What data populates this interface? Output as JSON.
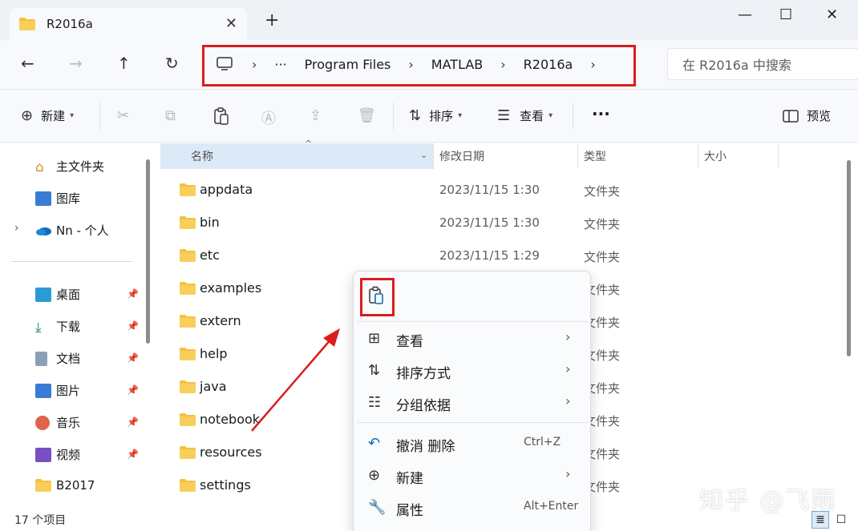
{
  "window": {
    "tab_title": "R2016a",
    "new_tab": "+",
    "minimize": "—",
    "maximize": "☐",
    "close": "✕"
  },
  "nav": {
    "breadcrumb": [
      "Program Files",
      "MATLAB",
      "R2016a"
    ],
    "ellipsis": "···",
    "search_placeholder": "在 R2016a 中搜索"
  },
  "toolbar": {
    "new_label": "新建",
    "sort_label": "排序",
    "view_label": "查看",
    "more_label": "···",
    "preview_label": "预览"
  },
  "sidebar": {
    "top": [
      {
        "label": "主文件夹",
        "icon": "home-icon"
      },
      {
        "label": "图库",
        "icon": "gallery-icon"
      },
      {
        "label": "Nn - 个人",
        "icon": "onedrive-icon"
      }
    ],
    "pinned": [
      {
        "label": "桌面",
        "icon": "desktop-icon"
      },
      {
        "label": "下载",
        "icon": "download-icon"
      },
      {
        "label": "文档",
        "icon": "documents-icon"
      },
      {
        "label": "图片",
        "icon": "pictures-icon"
      },
      {
        "label": "音乐",
        "icon": "music-icon"
      },
      {
        "label": "视频",
        "icon": "videos-icon"
      },
      {
        "label": "B2017",
        "icon": "folder-icon"
      }
    ]
  },
  "columns": {
    "name": "名称",
    "date": "修改日期",
    "type": "类型",
    "size": "大小"
  },
  "files": [
    {
      "name": "appdata",
      "date": "2023/11/15 1:30",
      "type": "文件夹"
    },
    {
      "name": "bin",
      "date": "2023/11/15 1:30",
      "type": "文件夹"
    },
    {
      "name": "etc",
      "date": "2023/11/15 1:29",
      "type": "文件夹"
    },
    {
      "name": "examples",
      "date": "",
      "type": "文件夹"
    },
    {
      "name": "extern",
      "date": "",
      "type": "文件夹"
    },
    {
      "name": "help",
      "date": "",
      "type": "文件夹"
    },
    {
      "name": "java",
      "date": "",
      "type": "文件夹"
    },
    {
      "name": "notebook",
      "date": "",
      "type": "文件夹"
    },
    {
      "name": "resources",
      "date": "",
      "type": "文件夹"
    },
    {
      "name": "settings",
      "date": "",
      "type": "文件夹"
    }
  ],
  "status": {
    "count": "17 个项目"
  },
  "context_menu": {
    "items": [
      {
        "label": "查看",
        "shortcut": ""
      },
      {
        "label": "排序方式",
        "shortcut": ""
      },
      {
        "label": "分组依据",
        "shortcut": ""
      },
      {
        "label": "撤消 删除",
        "shortcut": "Ctrl+Z"
      },
      {
        "label": "新建",
        "shortcut": ""
      },
      {
        "label": "属性",
        "shortcut": "Alt+Enter"
      }
    ]
  },
  "watermark": "知乎 @飞雨",
  "colors": {
    "highlight_red": "#d81e1e",
    "folder_yellow": "#f4c241",
    "accent_blue": "#0067c0"
  }
}
